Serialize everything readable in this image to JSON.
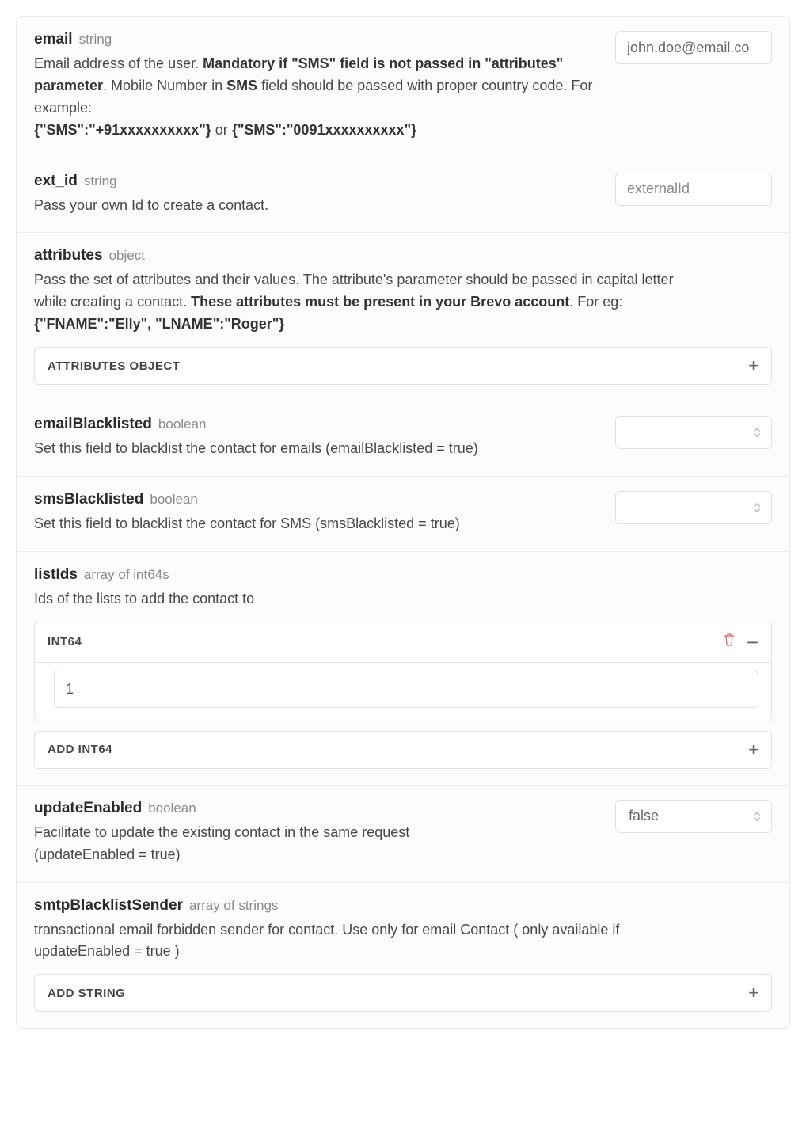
{
  "params": {
    "email": {
      "name": "email",
      "type": "string",
      "desc_pre": "Email address of the user. ",
      "desc_bold1": "Mandatory if \"SMS\" field is not passed in \"attributes\" parameter",
      "desc_mid1": ". Mobile Number in ",
      "desc_bold2": "SMS",
      "desc_mid2": " field should be passed with proper country code. For example:",
      "example1": "{\"SMS\":\"+91xxxxxxxxxx\"}",
      "example_sep": " or ",
      "example2": "{\"SMS\":\"0091xxxxxxxxxx\"}",
      "value": "john.doe@email.co"
    },
    "ext_id": {
      "name": "ext_id",
      "type": "string",
      "desc": "Pass your own Id to create a contact.",
      "placeholder": "externalId"
    },
    "attributes": {
      "name": "attributes",
      "type": "object",
      "desc_pre": "Pass the set of attributes and their values. The attribute's parameter should be passed in capital letter while creating a contact. ",
      "desc_bold": "These attributes must be present in your Brevo account",
      "desc_post": ". For eg:",
      "example": "{\"FNAME\":\"Elly\", \"LNAME\":\"Roger\"}",
      "expander_label": "ATTRIBUTES OBJECT"
    },
    "emailBlacklisted": {
      "name": "emailBlacklisted",
      "type": "boolean",
      "desc": "Set this field to blacklist the contact for emails (emailBlacklisted = true)"
    },
    "smsBlacklisted": {
      "name": "smsBlacklisted",
      "type": "boolean",
      "desc": "Set this field to blacklist the contact for SMS (smsBlacklisted = true)"
    },
    "listIds": {
      "name": "listIds",
      "type": "array of int64s",
      "desc": "Ids of the lists to add the contact to",
      "item_label": "INT64",
      "item_value": "1",
      "add_label": "ADD INT64"
    },
    "updateEnabled": {
      "name": "updateEnabled",
      "type": "boolean",
      "desc": "Facilitate to update the existing contact in the same request (updateEnabled = true)",
      "value": "false"
    },
    "smtpBlacklistSender": {
      "name": "smtpBlacklistSender",
      "type": "array of strings",
      "desc": "transactional email forbidden sender for contact. Use only for email Contact ( only available if updateEnabled = true )",
      "add_label": "ADD STRING"
    }
  }
}
